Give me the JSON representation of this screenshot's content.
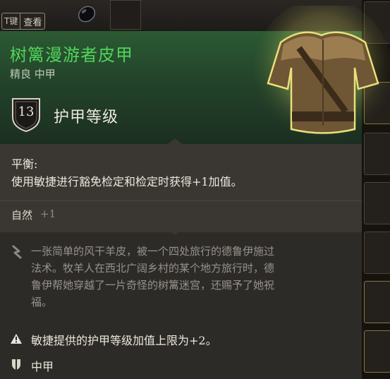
{
  "hotkey": {
    "key": "T键",
    "action": "查看"
  },
  "item": {
    "name": "树篱漫游者皮甲",
    "subtitle": "精良 中甲",
    "armor_class": {
      "value": "13",
      "label": "护甲等级"
    },
    "passive": {
      "title": "平衡:",
      "description": "使用敏捷进行豁免检定和检定时获得+1加值。"
    },
    "skill": {
      "name": "自然",
      "bonus": "+1"
    },
    "description_lines": [
      "一张简单的风干羊皮，被一个四处旅行的德鲁伊施过",
      "法术。牧羊人在西北广阔乡村的某个地方旅行时，德",
      "鲁伊帮她穿越了一片奇怪的树篱迷宫，还赐予了她祝",
      "福。"
    ],
    "warning": "敏捷提供的护甲等级加值上限为+2。",
    "armor_type": "中甲"
  },
  "colors": {
    "rarity_uncommon": "#4fd45a",
    "header_green": "#2c5a33",
    "panel": "#2d2b28",
    "panel_light": "#3a3733",
    "text": "#ece7dd",
    "muted": "#97918a"
  },
  "icons": [
    "gem-icon",
    "shield-icon",
    "leather-armor-icon",
    "quill-icon",
    "warning-icon",
    "medium-armor-icon"
  ]
}
